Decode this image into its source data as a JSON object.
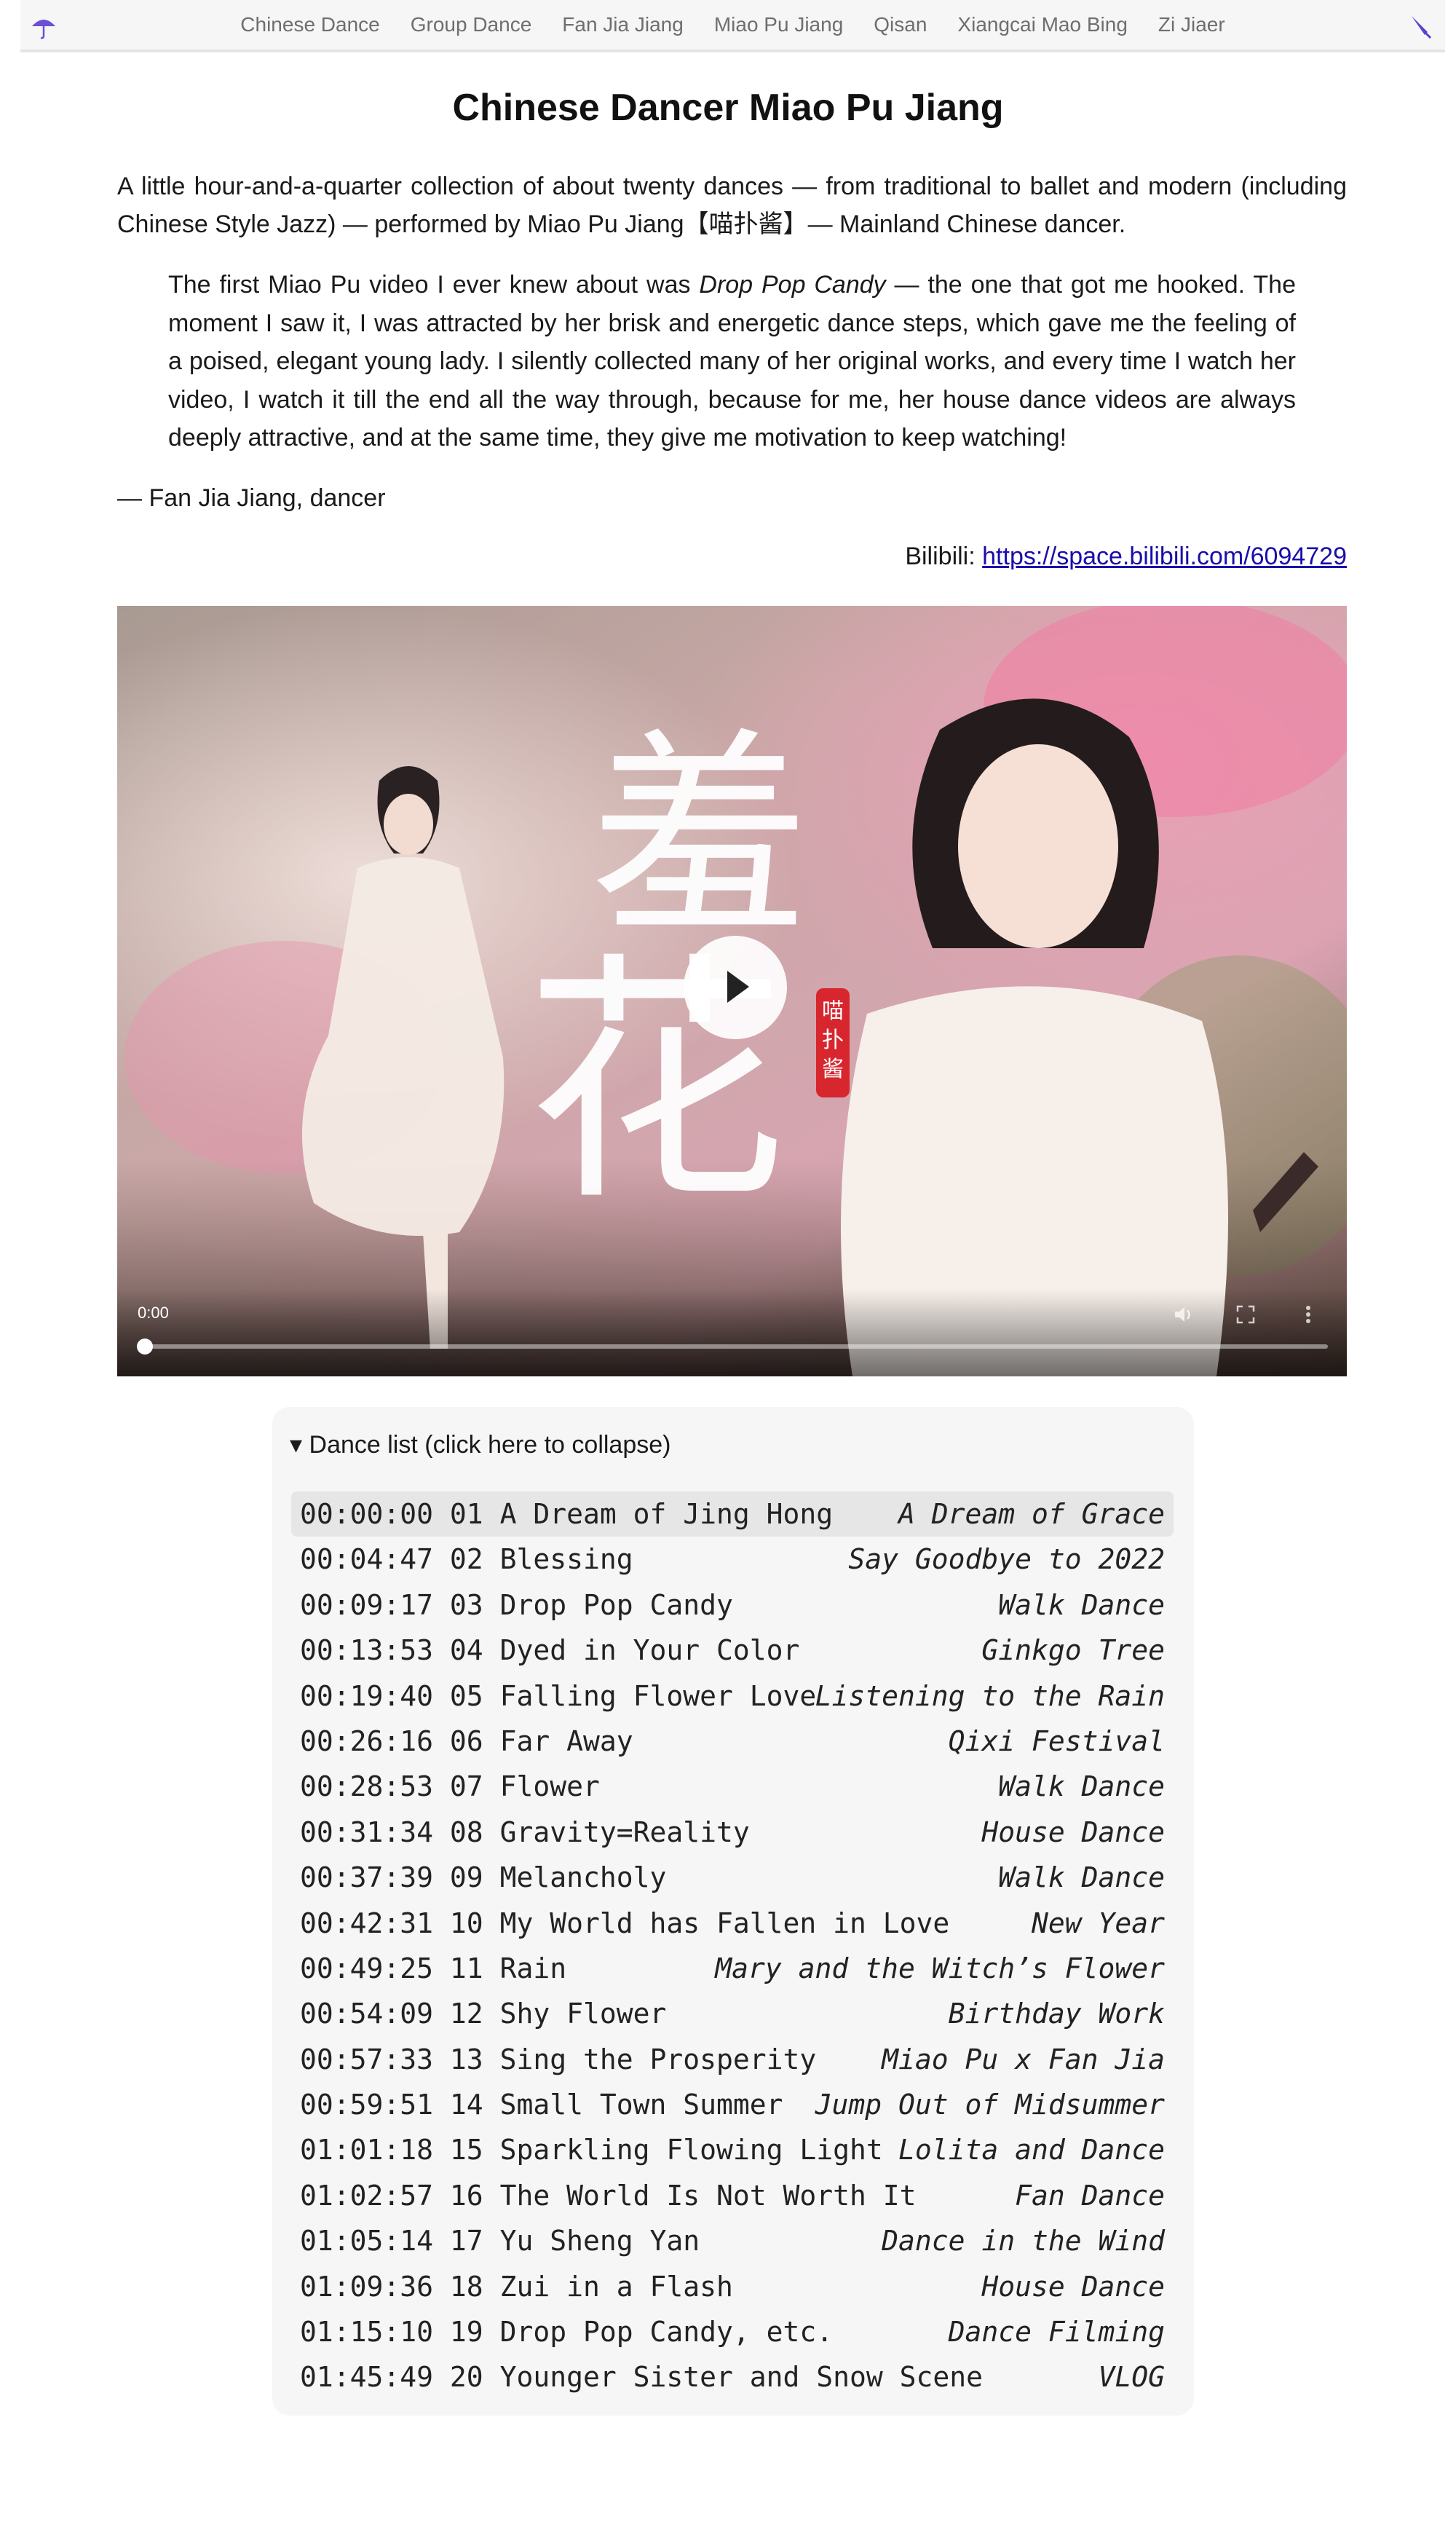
{
  "nav": {
    "brand_icon": "umbrella-icon",
    "right_icon": "closed-umbrella-icon",
    "links": [
      "Chinese Dance",
      "Group Dance",
      "Fan Jia Jiang",
      "Miao Pu Jiang",
      "Qisan",
      "Xiangcai Mao Bing",
      "Zi Jiaer"
    ]
  },
  "article": {
    "title": "Chinese Dancer Miao Pu Jiang",
    "intro": "A little hour-and-a-quarter collection of about twenty dances — from traditional to ballet and modern (including Chinese Style Jazz) — performed by Miao Pu Jiang【喵扑酱】— Mainland Chinese dancer.",
    "quote_before": "The first Miao Pu video I ever knew about was ",
    "quote_em": "Drop Pop Candy",
    "quote_after": " — the one that got me hooked. The moment I saw it, I was attracted by her brisk and energetic dance steps, which gave me the feeling of a poised, elegant young lady. I silently collected many of her original works, and every time I watch her video, I watch it till the end all the way through, because for me, her house dance videos are always deeply attractive, and at the same time, they give me motivation to keep watching!",
    "cite": "— Fan Jia Jiang, dancer",
    "bili_label": "Bilibili: ",
    "bili_url": "https://space.bilibili.com/6094729"
  },
  "video": {
    "current_time": "0:00",
    "progress": 0,
    "poster_title": "羞花",
    "poster_seal": "喵扑酱"
  },
  "dance_list": {
    "summary": "▾ Dance list (click here to collapse)",
    "rows": [
      {
        "time": "00:00:00",
        "num": "01",
        "title": "A Dream of Jing Hong",
        "note": "A Dream of Grace"
      },
      {
        "time": "00:04:47",
        "num": "02",
        "title": "Blessing",
        "note": "Say Goodbye to 2022"
      },
      {
        "time": "00:09:17",
        "num": "03",
        "title": "Drop Pop Candy",
        "note": "Walk Dance"
      },
      {
        "time": "00:13:53",
        "num": "04",
        "title": "Dyed in Your Color",
        "note": "Ginkgo Tree"
      },
      {
        "time": "00:19:40",
        "num": "05",
        "title": "Falling Flower Love",
        "note": "Listening to the Rain"
      },
      {
        "time": "00:26:16",
        "num": "06",
        "title": "Far Away",
        "note": "Qixi Festival"
      },
      {
        "time": "00:28:53",
        "num": "07",
        "title": "Flower",
        "note": "Walk Dance"
      },
      {
        "time": "00:31:34",
        "num": "08",
        "title": "Gravity=Reality",
        "note": "House Dance"
      },
      {
        "time": "00:37:39",
        "num": "09",
        "title": "Melancholy",
        "note": "Walk Dance"
      },
      {
        "time": "00:42:31",
        "num": "10",
        "title": "My World has Fallen in Love",
        "note": "New Year"
      },
      {
        "time": "00:49:25",
        "num": "11",
        "title": "Rain",
        "note": "Mary and the Witch’s Flower"
      },
      {
        "time": "00:54:09",
        "num": "12",
        "title": "Shy Flower",
        "note": "Birthday Work"
      },
      {
        "time": "00:57:33",
        "num": "13",
        "title": "Sing the Prosperity",
        "note": "Miao Pu x Fan Jia"
      },
      {
        "time": "00:59:51",
        "num": "14",
        "title": "Small Town Summer",
        "note": "Jump Out of Midsummer"
      },
      {
        "time": "01:01:18",
        "num": "15",
        "title": "Sparkling Flowing Light",
        "note": "Lolita and Dance"
      },
      {
        "time": "01:02:57",
        "num": "16",
        "title": "The World Is Not Worth It",
        "note": "Fan Dance"
      },
      {
        "time": "01:05:14",
        "num": "17",
        "title": "Yu Sheng Yan",
        "note": "Dance in the Wind"
      },
      {
        "time": "01:09:36",
        "num": "18",
        "title": "Zui in a Flash",
        "note": "House Dance"
      },
      {
        "time": "01:15:10",
        "num": "19",
        "title": "Drop Pop Candy, etc.",
        "note": "Dance Filming"
      },
      {
        "time": "01:45:49",
        "num": "20",
        "title": "Younger Sister and Snow Scene",
        "note": "VLOG"
      }
    ]
  }
}
